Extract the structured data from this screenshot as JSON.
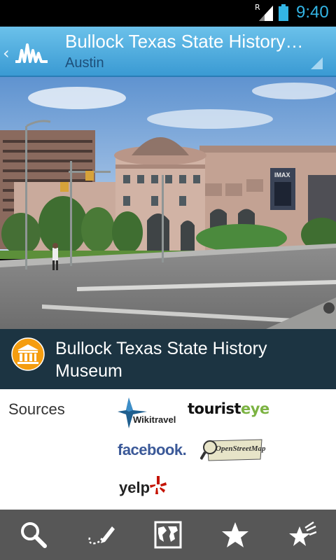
{
  "status_bar": {
    "time": "9:40",
    "roaming_indicator": "R",
    "icons": [
      "signal-icon",
      "battery-icon"
    ]
  },
  "action_bar": {
    "title": "Bullock Texas State History Museum",
    "subtitle": "Austin",
    "icons": [
      "back-chevron-icon",
      "app-logo-icon",
      "overflow-corner-icon"
    ]
  },
  "place": {
    "name": "Bullock Texas State History Museum",
    "category_icon": "museum-icon",
    "billboard_text": "IMAX"
  },
  "sources": {
    "label": "Sources",
    "items": [
      {
        "id": "wikitravel",
        "label": "Wikitravel"
      },
      {
        "id": "touristeye",
        "label_a": "tourist",
        "label_b": "eye"
      },
      {
        "id": "facebook",
        "label": "facebook."
      },
      {
        "id": "openstreetmap",
        "label": "OpenStreetMap"
      },
      {
        "id": "yelp",
        "label": "yelp"
      }
    ]
  },
  "bottom_nav": {
    "items": [
      {
        "id": "search",
        "icon": "search-icon"
      },
      {
        "id": "route",
        "icon": "route-pencil-icon"
      },
      {
        "id": "map",
        "icon": "map-icon"
      },
      {
        "id": "favorites",
        "icon": "star-icon"
      },
      {
        "id": "recent",
        "icon": "star-trail-icon"
      }
    ]
  },
  "colors": {
    "action_bar": "#4aaee0",
    "title_band": "#1c3442",
    "bottom_bar": "#575757",
    "status_time": "#33b5e5",
    "museum_icon_bg": "#f59d0f"
  }
}
